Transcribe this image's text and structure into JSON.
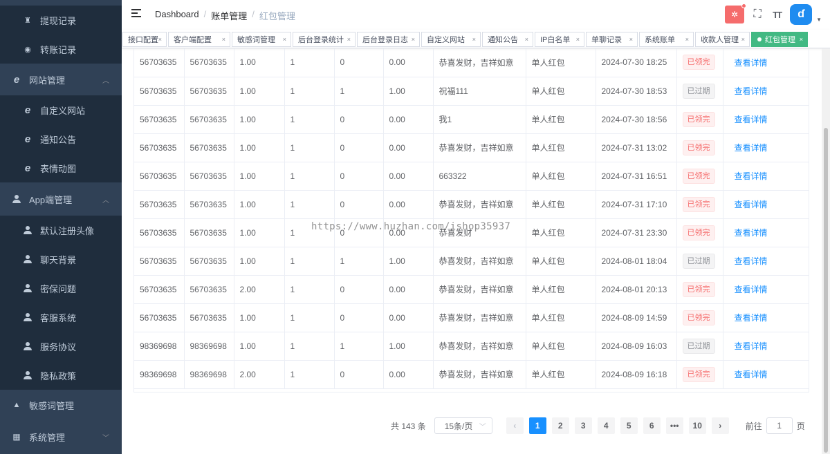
{
  "sidebar": {
    "items": [
      {
        "label": "提现记录",
        "type": "sub",
        "icon": "money-bag-icon"
      },
      {
        "label": "转账记录",
        "type": "sub",
        "icon": "transfer-icon"
      },
      {
        "label": "网站管理",
        "type": "group",
        "icon": "ie-icon",
        "arrow": "︿"
      },
      {
        "label": "自定义网站",
        "type": "sub",
        "icon": "ie-icon"
      },
      {
        "label": "通知公告",
        "type": "sub",
        "icon": "ie-icon"
      },
      {
        "label": "表情动图",
        "type": "sub",
        "icon": "ie-icon"
      },
      {
        "label": "App端管理",
        "type": "group",
        "icon": "user-icon",
        "arrow": "︿"
      },
      {
        "label": "默认注册头像",
        "type": "sub",
        "icon": "user-icon"
      },
      {
        "label": "聊天背景",
        "type": "sub",
        "icon": "user-icon"
      },
      {
        "label": "密保问题",
        "type": "sub",
        "icon": "user-icon"
      },
      {
        "label": "客服系统",
        "type": "sub",
        "icon": "user-icon"
      },
      {
        "label": "服务协议",
        "type": "sub",
        "icon": "user-icon"
      },
      {
        "label": "隐私政策",
        "type": "sub",
        "icon": "user-icon"
      },
      {
        "label": "敏感词管理",
        "type": "group",
        "icon": "warning-icon"
      },
      {
        "label": "系统管理",
        "type": "group",
        "icon": "system-icon",
        "arrow": "﹀"
      }
    ]
  },
  "header": {
    "breadcrumb": [
      "Dashboard",
      "账单管理",
      "红包管理"
    ],
    "bug_icon": "bug-icon",
    "fullscreen_icon": "fullscreen-icon",
    "font_size_icon": "font-size-icon",
    "avatar_icon": "avatar-icon",
    "bug_glyph": "✲",
    "fullscreen_glyph": "⛶",
    "font_size_glyph": "TT",
    "avatar_glyph": "ɗ",
    "caret_glyph": "▼"
  },
  "tags": [
    {
      "label": "接口配置"
    },
    {
      "label": "客户端配置"
    },
    {
      "label": "敏感词管理"
    },
    {
      "label": "后台登录统计"
    },
    {
      "label": "后台登录日志"
    },
    {
      "label": "自定义网站"
    },
    {
      "label": "通知公告"
    },
    {
      "label": "IP白名单"
    },
    {
      "label": "单聊记录"
    },
    {
      "label": "系统账单"
    },
    {
      "label": "收款人管理"
    },
    {
      "label": "红包管理",
      "active": true
    }
  ],
  "tag_close": "×",
  "table": {
    "rows": [
      [
        "56703635",
        "56703635",
        "1.00",
        "1",
        "0",
        "0.00",
        "恭喜发财，吉祥如意",
        "单人红包",
        "2024-07-30 18:25",
        "已领完",
        "查看详情"
      ],
      [
        "56703635",
        "56703635",
        "1.00",
        "1",
        "1",
        "1.00",
        "祝福111",
        "单人红包",
        "2024-07-30 18:53",
        "已过期",
        "查看详情"
      ],
      [
        "56703635",
        "56703635",
        "1.00",
        "1",
        "0",
        "0.00",
        "我1",
        "单人红包",
        "2024-07-30 18:56",
        "已领完",
        "查看详情"
      ],
      [
        "56703635",
        "56703635",
        "1.00",
        "1",
        "0",
        "0.00",
        "恭喜发财，吉祥如意",
        "单人红包",
        "2024-07-31 13:02",
        "已领完",
        "查看详情"
      ],
      [
        "56703635",
        "56703635",
        "1.00",
        "1",
        "0",
        "0.00",
        "663322",
        "单人红包",
        "2024-07-31 16:51",
        "已领完",
        "查看详情"
      ],
      [
        "56703635",
        "56703635",
        "1.00",
        "1",
        "0",
        "0.00",
        "恭喜发财，吉祥如意",
        "单人红包",
        "2024-07-31 17:10",
        "已领完",
        "查看详情"
      ],
      [
        "56703635",
        "56703635",
        "1.00",
        "1",
        "0",
        "0.00",
        "恭喜发财",
        "单人红包",
        "2024-07-31 23:30",
        "已领完",
        "查看详情"
      ],
      [
        "56703635",
        "56703635",
        "1.00",
        "1",
        "1",
        "1.00",
        "恭喜发财，吉祥如意",
        "单人红包",
        "2024-08-01 18:04",
        "已过期",
        "查看详情"
      ],
      [
        "56703635",
        "56703635",
        "2.00",
        "1",
        "0",
        "0.00",
        "恭喜发财，吉祥如意",
        "单人红包",
        "2024-08-01 20:13",
        "已领完",
        "查看详情"
      ],
      [
        "56703635",
        "56703635",
        "1.00",
        "1",
        "0",
        "0.00",
        "恭喜发财，吉祥如意",
        "单人红包",
        "2024-08-09 14:59",
        "已领完",
        "查看详情"
      ],
      [
        "98369698",
        "98369698",
        "1.00",
        "1",
        "1",
        "1.00",
        "恭喜发财，吉祥如意",
        "单人红包",
        "2024-08-09 16:03",
        "已过期",
        "查看详情"
      ],
      [
        "98369698",
        "98369698",
        "2.00",
        "1",
        "0",
        "0.00",
        "恭喜发财，吉祥如意",
        "单人红包",
        "2024-08-09 16:18",
        "已领完",
        "查看详情"
      ]
    ],
    "status_colors": {
      "已领完": "#f56c6c",
      "已过期": "#909399"
    }
  },
  "pagination": {
    "total": "共 143 条",
    "page_size": "15条/页",
    "prev": "‹",
    "pages": [
      "1",
      "2",
      "3",
      "4",
      "5",
      "6",
      "•••",
      "10"
    ],
    "current": "1",
    "next": "›",
    "goto_label": "前往",
    "goto_value": "1",
    "page_suffix": "页"
  },
  "watermark": "https://www.huzhan.com/ishop35937",
  "colors": {
    "sidebar_bg": "#304156",
    "submenu_bg": "#1f2d3d",
    "active_tag": "#42b983",
    "primary": "#1890ff",
    "danger": "#f56c6c"
  }
}
